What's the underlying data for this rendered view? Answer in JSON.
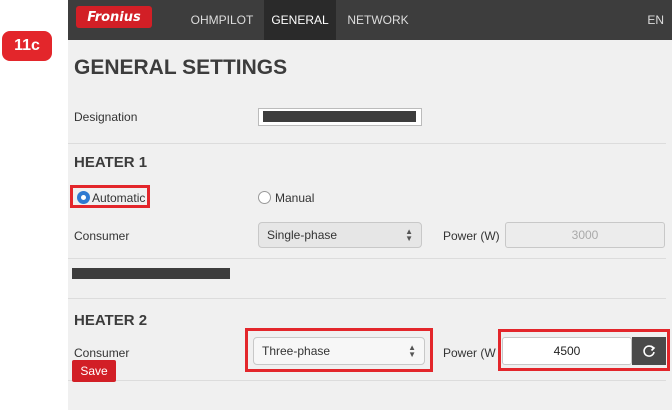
{
  "step_badge": "11c",
  "header": {
    "logo_text": "Fronius",
    "tabs": [
      "OHMPILOT",
      "GENERAL",
      "NETWORK"
    ],
    "active_tab": "GENERAL",
    "language": "EN"
  },
  "page": {
    "title": "GENERAL SETTINGS",
    "designation_label": "Designation"
  },
  "heater1": {
    "title": "HEATER 1",
    "mode_automatic": "Automatic",
    "mode_manual": "Manual",
    "selected_mode": "Automatic",
    "consumer_label": "Consumer",
    "consumer_value": "Single-phase",
    "power_label": "Power (W)",
    "power_value": "3000"
  },
  "heater2": {
    "title": "HEATER 2",
    "consumer_label": "Consumer",
    "consumer_value": "Three-phase",
    "power_label": "Power (W",
    "power_value": "4500"
  },
  "actions": {
    "save_label": "Save"
  },
  "colors": {
    "accent": "#d21f26",
    "radio_selected": "#2f7ad1",
    "topbar": "#3d3d3d"
  }
}
